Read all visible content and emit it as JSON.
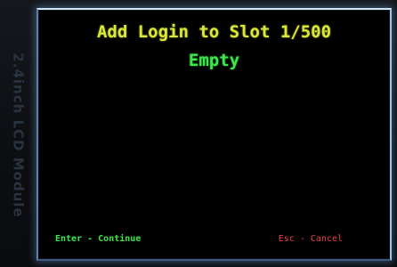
{
  "device": {
    "module_label": "2.4inch LCD Module"
  },
  "screen": {
    "title": "Add Login to Slot 1/500",
    "slot_status": "Empty",
    "hints": {
      "continue": "Enter - Continue",
      "cancel": "Esc - Cancel"
    }
  },
  "colors": {
    "title": "#dbe83a",
    "status": "#3ee64c",
    "continue_hint": "#3ee64c",
    "cancel_hint": "#e8424a",
    "screen_background": "#000000"
  }
}
